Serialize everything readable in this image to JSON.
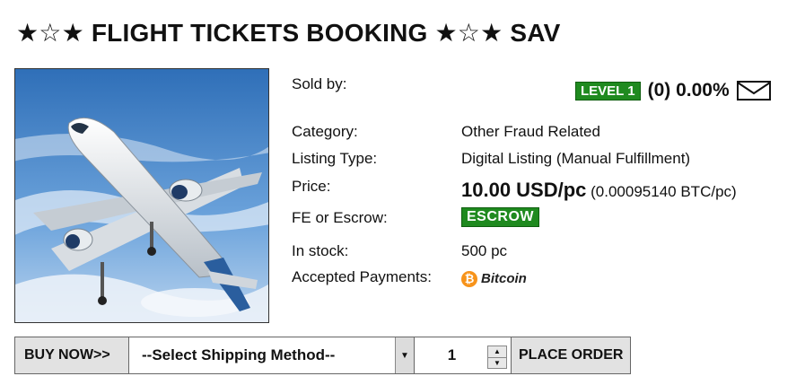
{
  "listing": {
    "title": "★☆★ FLIGHT TICKETS BOOKING ★☆★ SAV"
  },
  "seller": {
    "label": "Sold by:",
    "level": "LEVEL 1",
    "rating": "(0) 0.00%",
    "icon": "mail-icon"
  },
  "details": {
    "category_label": "Category:",
    "category_value": "Other Fraud Related",
    "listing_type_label": "Listing Type:",
    "listing_type_value": "Digital Listing (Manual Fulfillment)",
    "price_label": "Price:",
    "price_main": "10.00 USD/pc",
    "price_btc": "(0.00095140 BTC/pc)",
    "fe_label": "FE or Escrow:",
    "escrow_badge": "ESCROW",
    "stock_label": "In stock:",
    "stock_value": "500 pc",
    "payments_label": "Accepted Payments:",
    "payment_method": "Bitcoin",
    "payment_icon": "bitcoin-icon"
  },
  "order": {
    "buy_now_label": "BUY NOW>>",
    "shipping_selected": "--Select Shipping Method--",
    "quantity": "1",
    "place_order_label": "PLACE ORDER"
  },
  "colors": {
    "badge_green": "#1f8a1f",
    "bitcoin_orange": "#f7931a",
    "button_gray": "#e2e2e2"
  }
}
